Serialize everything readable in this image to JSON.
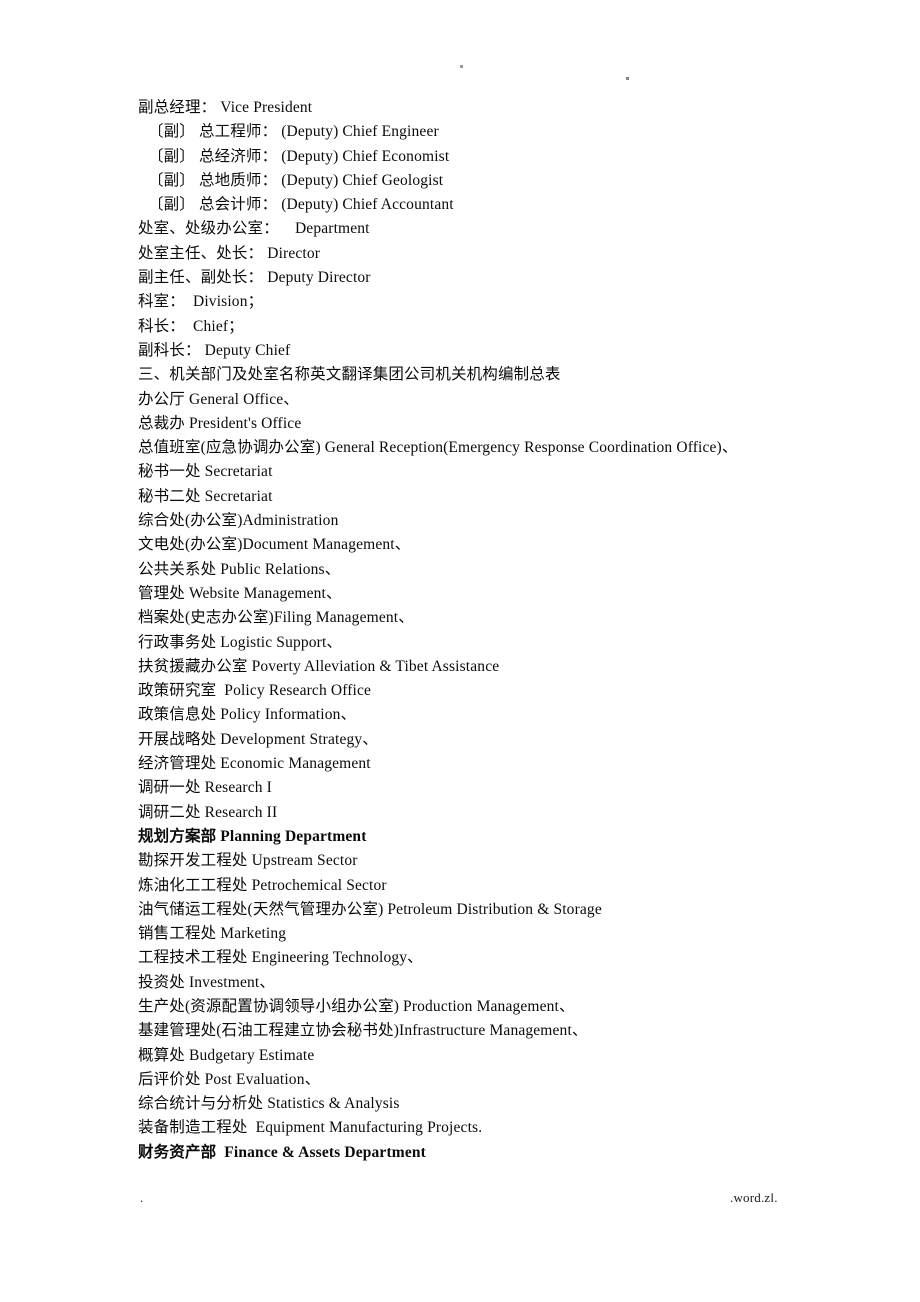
{
  "page": {
    "title": "机关部门及处室名称英文翻译",
    "background_color": "#ffffff",
    "text_color": "#000000"
  },
  "header": {
    "mark_one": "·",
    "mark_two": "·"
  },
  "footer": {
    "left_mark": ".",
    "right_watermark": ".word.zl."
  },
  "content": {
    "lines": [
      {
        "text": "副总经理： Vice President",
        "bold": false,
        "indent": false
      },
      {
        "text": "〔副〕 总工程师： (Deputy) Chief Engineer",
        "bold": false,
        "indent": true
      },
      {
        "text": "〔副〕 总经济师： (Deputy) Chief Economist",
        "bold": false,
        "indent": true
      },
      {
        "text": "〔副〕 总地质师： (Deputy) Chief Geologist",
        "bold": false,
        "indent": true
      },
      {
        "text": "〔副〕 总会计师： (Deputy) Chief Accountant",
        "bold": false,
        "indent": true
      },
      {
        "text": "处室、处级办公室：    Department",
        "bold": false,
        "indent": false
      },
      {
        "text": "处室主任、处长： Director",
        "bold": false,
        "indent": false
      },
      {
        "text": "副主任、副处长： Deputy Director",
        "bold": false,
        "indent": false
      },
      {
        "text": "科室：  Division；",
        "bold": false,
        "indent": false
      },
      {
        "text": "科长：  Chief；",
        "bold": false,
        "indent": false
      },
      {
        "text": "副科长： Deputy Chief",
        "bold": false,
        "indent": false
      },
      {
        "text": "三、机关部门及处室名称英文翻译集团公司机关机构编制总表",
        "bold": false,
        "indent": false
      },
      {
        "text": "办公厅 General Office、",
        "bold": false,
        "indent": false
      },
      {
        "text": "总裁办 President's Office",
        "bold": false,
        "indent": false
      },
      {
        "text": "总值班室(应急协调办公室) General Reception(Emergency Response Coordination Office)、",
        "bold": false,
        "indent": false
      },
      {
        "text": "秘书一处 Secretariat",
        "bold": false,
        "indent": false
      },
      {
        "text": "秘书二处 Secretariat",
        "bold": false,
        "indent": false
      },
      {
        "text": "综合处(办公室)Administration",
        "bold": false,
        "indent": false
      },
      {
        "text": "文电处(办公室)Document Management、",
        "bold": false,
        "indent": false
      },
      {
        "text": "公共关系处 Public Relations、",
        "bold": false,
        "indent": false
      },
      {
        "text": "管理处 Website Management、",
        "bold": false,
        "indent": false
      },
      {
        "text": "档案处(史志办公室)Filing Management、",
        "bold": false,
        "indent": false
      },
      {
        "text": "行政事务处 Logistic Support、",
        "bold": false,
        "indent": false
      },
      {
        "text": "扶贫援藏办公室 Poverty Alleviation & Tibet Assistance",
        "bold": false,
        "indent": false
      },
      {
        "text": "政策研究室  Policy Research Office",
        "bold": false,
        "indent": false
      },
      {
        "text": "政策信息处 Policy Information、",
        "bold": false,
        "indent": false
      },
      {
        "text": "开展战略处 Development Strategy、",
        "bold": false,
        "indent": false
      },
      {
        "text": "经济管理处 Economic Management",
        "bold": false,
        "indent": false
      },
      {
        "text": "调研一处 Research I",
        "bold": false,
        "indent": false
      },
      {
        "text": "调研二处 Research II",
        "bold": false,
        "indent": false
      },
      {
        "text": "规划方案部 Planning Department",
        "bold": true,
        "indent": false
      },
      {
        "text": "勘探开发工程处 Upstream Sector",
        "bold": false,
        "indent": false
      },
      {
        "text": "炼油化工工程处 Petrochemical Sector",
        "bold": false,
        "indent": false
      },
      {
        "text": "油气储运工程处(天然气管理办公室) Petroleum Distribution & Storage",
        "bold": false,
        "indent": false
      },
      {
        "text": "销售工程处 Marketing",
        "bold": false,
        "indent": false
      },
      {
        "text": "工程技术工程处 Engineering Technology、",
        "bold": false,
        "indent": false
      },
      {
        "text": "投资处 Investment、",
        "bold": false,
        "indent": false
      },
      {
        "text": "生产处(资源配置协调领导小组办公室) Production Management、",
        "bold": false,
        "indent": false
      },
      {
        "text": "基建管理处(石油工程建立协会秘书处)Infrastructure Management、",
        "bold": false,
        "indent": false
      },
      {
        "text": "概算处 Budgetary Estimate",
        "bold": false,
        "indent": false
      },
      {
        "text": "后评价处 Post Evaluation、",
        "bold": false,
        "indent": false
      },
      {
        "text": "综合统计与分析处 Statistics & Analysis",
        "bold": false,
        "indent": false
      },
      {
        "text": "装备制造工程处  Equipment Manufacturing Projects.",
        "bold": false,
        "indent": false
      },
      {
        "text": "财务资产部  Finance & Assets Department",
        "bold": true,
        "indent": false
      }
    ]
  }
}
